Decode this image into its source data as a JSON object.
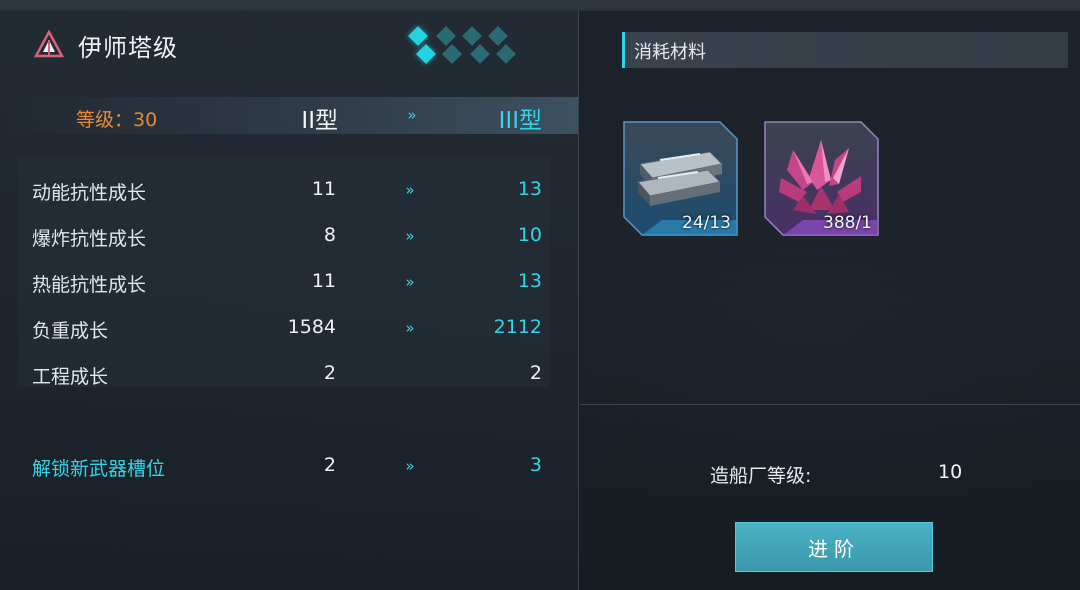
{
  "ship": {
    "name": "伊师塔级",
    "tier_diamonds_total": 8,
    "tier_diamonds_active": 2
  },
  "level_row": {
    "level_text": "等级：30",
    "type_from": "II型",
    "arrow": "»",
    "type_to": "III型"
  },
  "stats": [
    {
      "name": "动能抗性成长",
      "current": "11",
      "arrow": "»",
      "next": "13"
    },
    {
      "name": "爆炸抗性成长",
      "current": "8",
      "arrow": "»",
      "next": "10"
    },
    {
      "name": "热能抗性成长",
      "current": "11",
      "arrow": "»",
      "next": "13"
    },
    {
      "name": "负重成长",
      "current": "1584",
      "arrow": "»",
      "next": "2112"
    },
    {
      "name": "工程成长",
      "current": "2",
      "arrow": "",
      "next": "2"
    }
  ],
  "unlock": {
    "name": "解锁新武器槽位",
    "current": "2",
    "arrow": "»",
    "next": "3"
  },
  "materials": {
    "title": "消耗材料",
    "items": [
      {
        "icon": "metal-plates-icon",
        "count": "24/13",
        "rarity_color": "#2f8fc0"
      },
      {
        "icon": "pink-crystal-icon",
        "count": "388/1",
        "rarity_color": "#8a4fc0"
      }
    ]
  },
  "shipyard": {
    "label": "造船厂等级:",
    "value": "10"
  },
  "upgrade_button": {
    "label": "进阶"
  },
  "colors": {
    "accent": "#35d3e6",
    "level": "#e88a2f",
    "button": "#45a8bd"
  }
}
